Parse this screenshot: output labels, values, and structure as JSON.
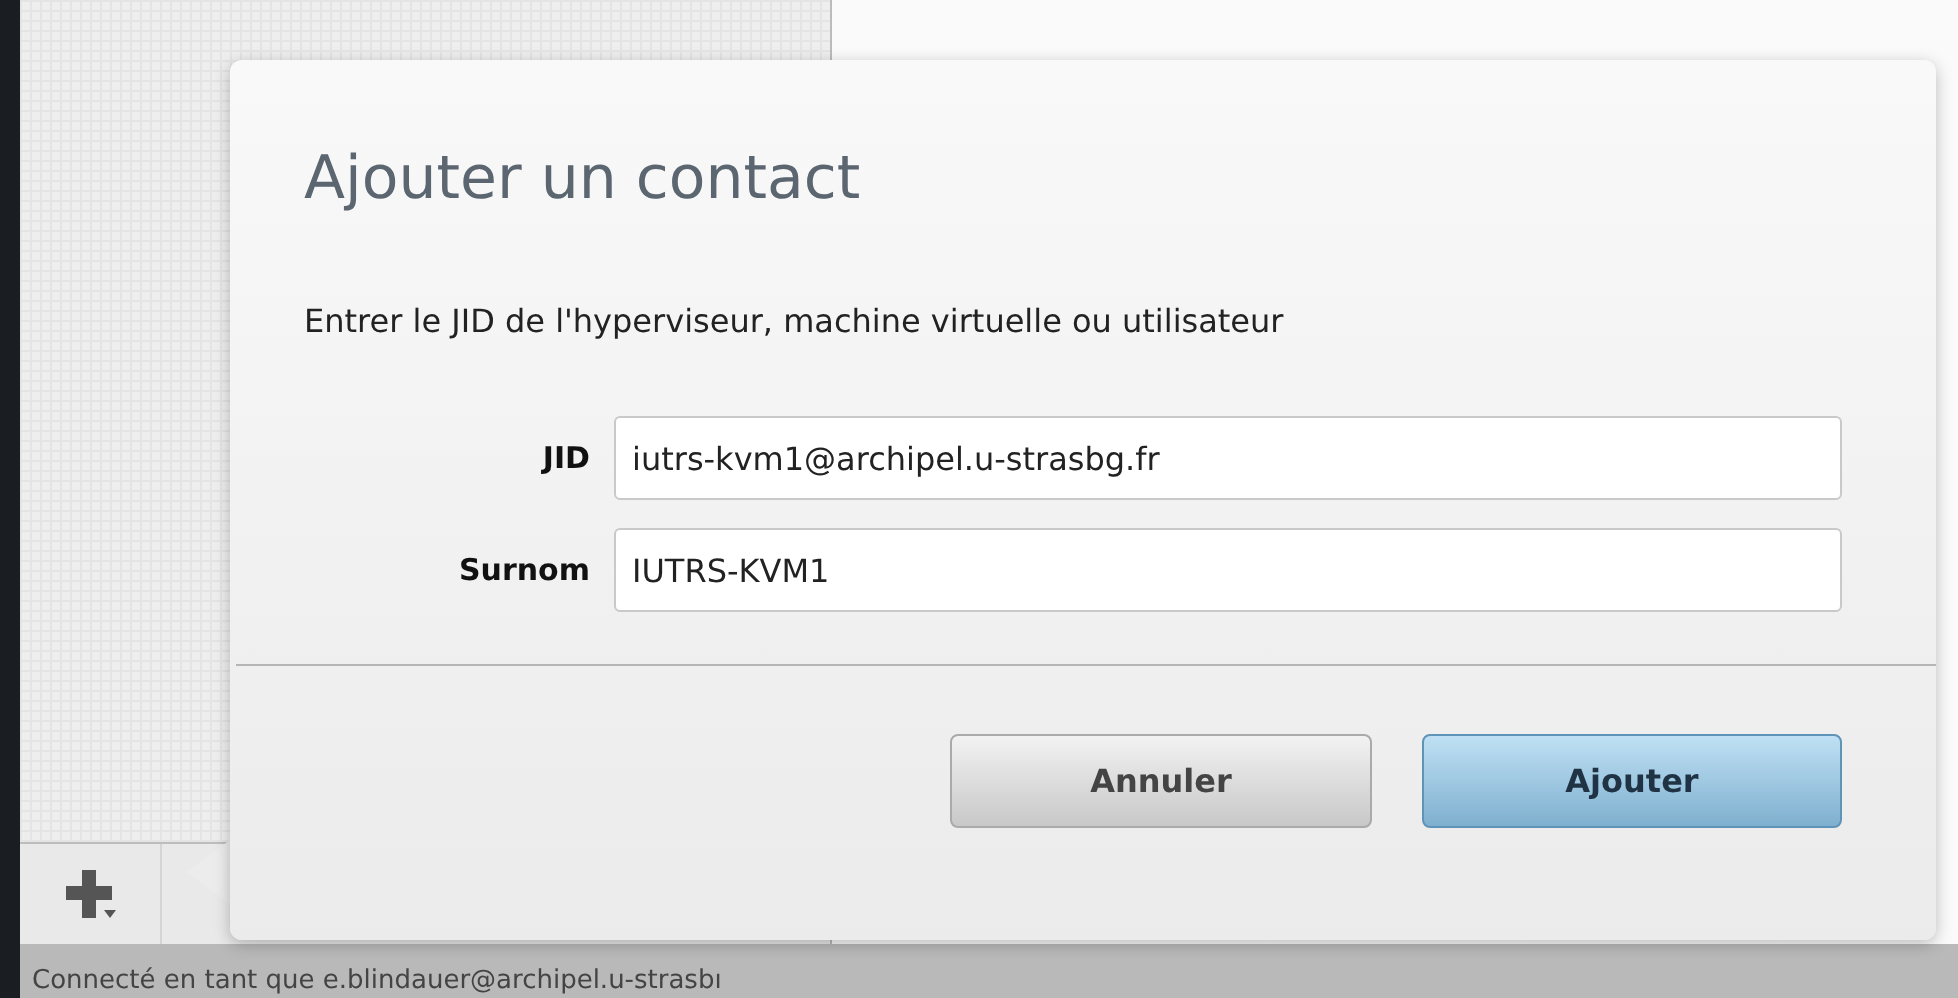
{
  "dialog": {
    "title": "Ajouter un contact",
    "message": "Entrer le JID de l'hyperviseur, machine virtuelle ou utilisateur",
    "fields": [
      {
        "label": "JID",
        "value": "iutrs-kvm1@archipel.u-strasbg.fr"
      },
      {
        "label": "Surnom",
        "value": "IUTRS-KVM1"
      }
    ],
    "buttons": [
      {
        "label": "Annuler",
        "kind": "secondary"
      },
      {
        "label": "Ajouter",
        "kind": "primary"
      }
    ]
  },
  "status_bar": {
    "text": "Connecté en tant que e.blindauer@archipel.u-strasbı"
  }
}
